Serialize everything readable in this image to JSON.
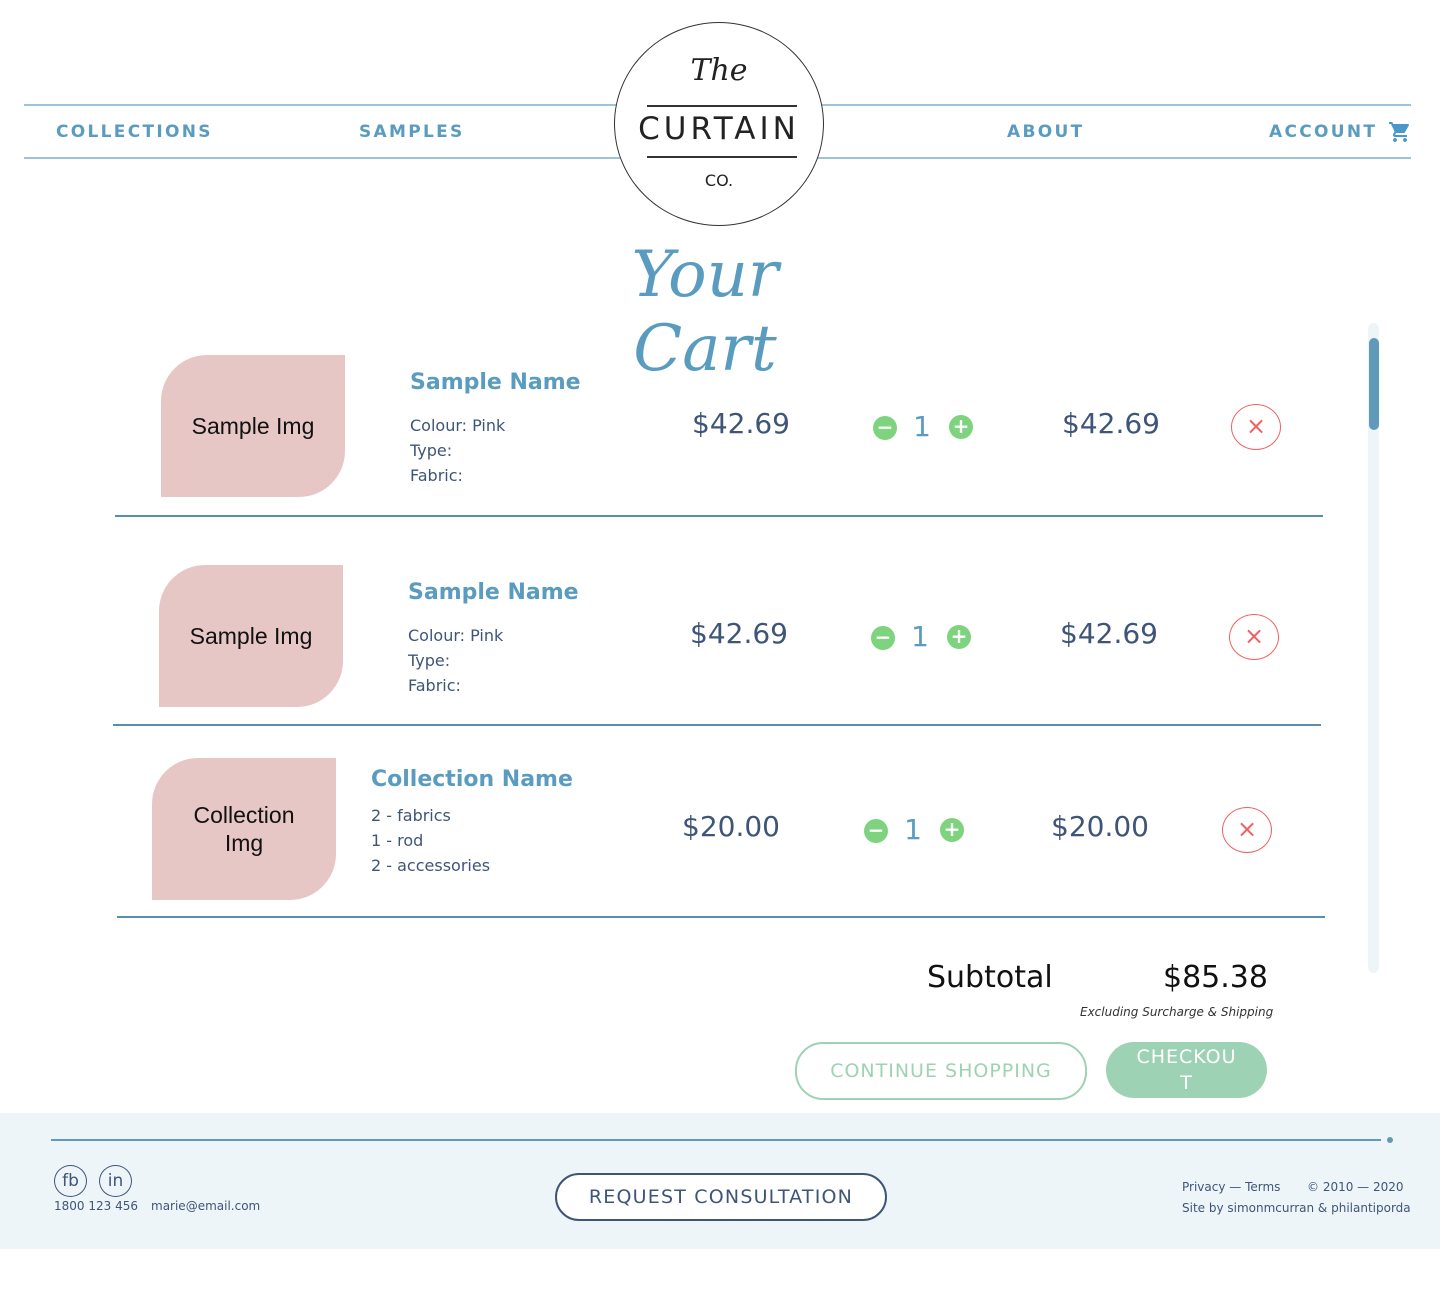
{
  "nav": {
    "collections": "COLLECTIONS",
    "samples": "SAMPLES",
    "about": "ABOUT",
    "account": "ACCOUNT"
  },
  "logo": {
    "the": "The",
    "word": "CURTAIN",
    "co": "CO."
  },
  "page_title": "Your Cart",
  "items": [
    {
      "image_label": "Sample Img",
      "name": "Sample Name",
      "details": [
        "Colour: Pink",
        "Type:",
        "Fabric:"
      ],
      "price": "$42.69",
      "quantity": "1",
      "total": "$42.69"
    },
    {
      "image_label": "Sample Img",
      "name": "Sample Name",
      "details": [
        "Colour: Pink",
        "Type:",
        "Fabric:"
      ],
      "price": "$42.69",
      "quantity": "1",
      "total": "$42.69"
    },
    {
      "image_label": "Collection Img",
      "name": "Collection Name",
      "details": [
        "2 - fabrics",
        "1 - rod",
        "2 - accessories"
      ],
      "price": "$20.00",
      "quantity": "1",
      "total": "$20.00"
    }
  ],
  "qty_minus": "−",
  "qty_plus": "+",
  "remove": "×",
  "summary": {
    "subtotal_label": "Subtotal",
    "subtotal_value": "$85.38",
    "note": "Excluding Surcharge & Shipping"
  },
  "buttons": {
    "continue": "CONTINUE SHOPPING",
    "checkout": "CHECKOUT"
  },
  "footer": {
    "fb": "fb",
    "in": "in",
    "phone": "1800 123 456",
    "email": "marie@email.com",
    "consultation": "REQUEST CONSULTATION",
    "legal": "Privacy — Terms",
    "copyright": "© 2010 — 2020",
    "credit": "Site by simonmcurran & philantiporda"
  },
  "colors": {
    "accent": "#5a9cbf",
    "text": "#3f5578",
    "thumb": "#e7c7c5",
    "green": "#7ed37e",
    "red": "#f06060",
    "button_green": "#9dd3b4",
    "footer_bg": "#edf5f8"
  },
  "icons": {
    "cart": "shopping-cart-icon"
  }
}
